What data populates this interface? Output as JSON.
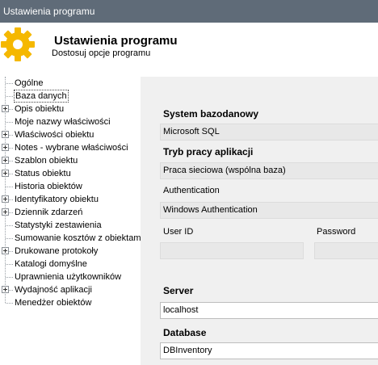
{
  "window": {
    "title": "Ustawienia programu"
  },
  "header": {
    "title": "Ustawienia programu",
    "subtitle": "Dostosuj opcje programu",
    "icon": "gear-icon",
    "icon_color": "#f5b800"
  },
  "tree": {
    "items": [
      {
        "label": "Ogólne",
        "expandable": false,
        "selected": false
      },
      {
        "label": "Baza danych",
        "expandable": false,
        "selected": true
      },
      {
        "label": "Opis obiektu",
        "expandable": true,
        "selected": false
      },
      {
        "label": "Moje nazwy właściwości",
        "expandable": false,
        "selected": false
      },
      {
        "label": "Właściwości obiektu",
        "expandable": true,
        "selected": false
      },
      {
        "label": "Notes - wybrane właściwości",
        "expandable": true,
        "selected": false
      },
      {
        "label": "Szablon obiektu",
        "expandable": true,
        "selected": false
      },
      {
        "label": "Status obiektu",
        "expandable": true,
        "selected": false
      },
      {
        "label": "Historia obiektów",
        "expandable": false,
        "selected": false
      },
      {
        "label": "Identyfikatory obiektu",
        "expandable": true,
        "selected": false
      },
      {
        "label": "Dziennik zdarzeń",
        "expandable": true,
        "selected": false
      },
      {
        "label": "Statystyki zestawienia",
        "expandable": false,
        "selected": false
      },
      {
        "label": "Sumowanie kosztów z obiektami",
        "expandable": false,
        "selected": false
      },
      {
        "label": "Drukowane protokoły",
        "expandable": true,
        "selected": false
      },
      {
        "label": "Katalogi domyślne",
        "expandable": false,
        "selected": false
      },
      {
        "label": "Uprawnienia użytkowników",
        "expandable": false,
        "selected": false
      },
      {
        "label": "Wydajność aplikacji",
        "expandable": true,
        "selected": false
      },
      {
        "label": "Menedżer obiektów",
        "expandable": false,
        "selected": false
      }
    ]
  },
  "db": {
    "system_label": "System bazodanowy",
    "system_value": "Microsoft SQL",
    "mode_label": "Tryb pracy aplikacji",
    "mode_value": "Praca sieciowa (wspólna baza)",
    "auth_label": "Authentication",
    "auth_value": "Windows Authentication",
    "userid_label": "User ID",
    "userid_value": "",
    "password_label": "Password",
    "password_value": "",
    "server_label": "Server",
    "server_value": "localhost",
    "database_label": "Database",
    "database_value": "DBInventory"
  }
}
